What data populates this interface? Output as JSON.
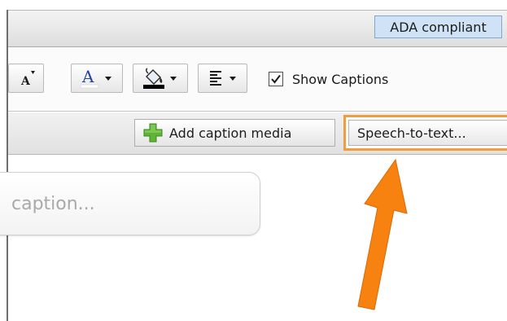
{
  "header": {
    "ada_badge": "ADA compliant"
  },
  "toolbar": {
    "font_size_icon": "font-size-icon",
    "font_color_icon": "font-color-icon",
    "background_color_icon": "paint-bucket-icon",
    "align_icon": "align-icon",
    "show_captions": {
      "label": "Show Captions",
      "checked": true
    }
  },
  "subbar": {
    "add_caption_media": "Add caption media",
    "speech_to_text": "Speech-to-text..."
  },
  "editor": {
    "caption_placeholder": "caption..."
  },
  "colors": {
    "highlight": "#f39c3d",
    "arrow": "#f7820f",
    "ada_badge_bg": "#cfe2f6",
    "font_color_swatch": "#ffffff",
    "fill_color_swatch": "#000000",
    "plus_icon": "#5fb336"
  }
}
